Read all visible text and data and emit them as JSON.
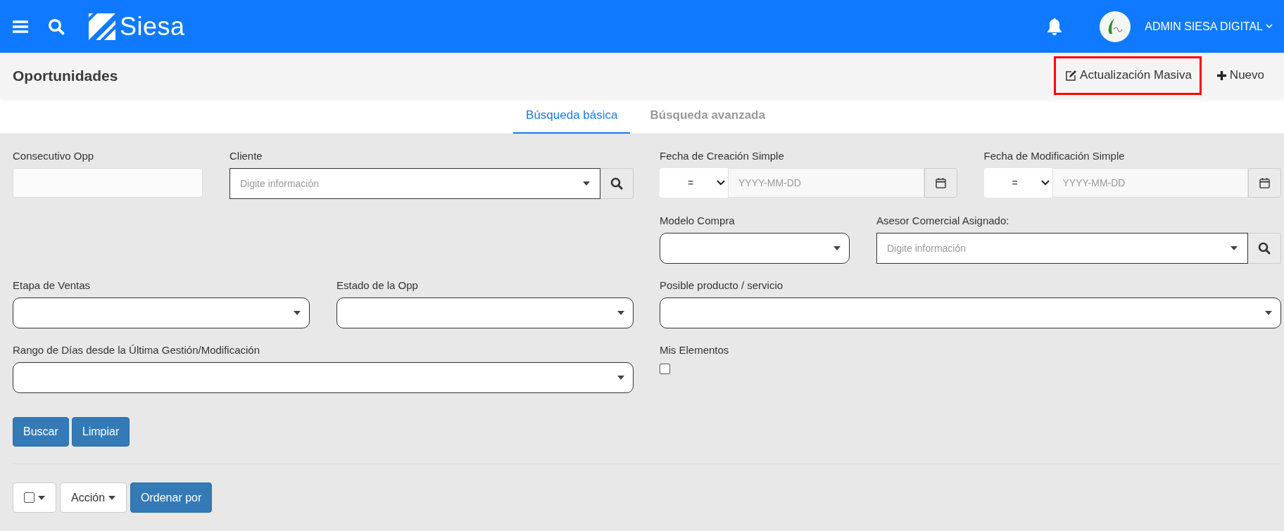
{
  "header": {
    "brand": "Siesa",
    "user": "ADMIN SIESA DIGITAL"
  },
  "page": {
    "title": "Oportunidades",
    "actions": [
      {
        "kind": "edit",
        "label": "Actualización Masiva",
        "highlighted": true
      },
      {
        "kind": "add",
        "label": "Nuevo",
        "highlighted": false
      }
    ]
  },
  "tabs": [
    {
      "label": "Búsqueda básica",
      "selected": true
    },
    {
      "label": "Búsqueda avanzada",
      "selected": false
    }
  ],
  "filter_rows": [
    {
      "left": [
        {
          "kind": "text",
          "label": "Consecutivo Opp"
        },
        {
          "kind": "lookup",
          "label": "Cliente",
          "placeholder": "Digite información"
        }
      ],
      "right": [
        {
          "kind": "date",
          "label": "Fecha de Creación Simple",
          "operator": "=",
          "placeholder": "YYYY-MM-DD"
        },
        {
          "kind": "date",
          "label": "Fecha de Modificación Simple",
          "operator": "=",
          "placeholder": "YYYY-MM-DD"
        }
      ]
    },
    {
      "left": [],
      "right": [
        {
          "kind": "select",
          "label": "Modelo Compra"
        },
        {
          "kind": "lookup",
          "label": "Asesor Comercial Asignado:",
          "placeholder": "Digite información"
        }
      ]
    },
    {
      "left": [
        {
          "kind": "select",
          "label": "Etapa de Ventas"
        },
        {
          "kind": "select",
          "label": "Estado de la Opp"
        }
      ],
      "right": [
        {
          "kind": "select",
          "label": "Posible producto / servicio"
        }
      ]
    },
    {
      "left": [
        {
          "kind": "select",
          "label": "Rango de Días desde la Última Gestión/Modificación"
        }
      ],
      "right": [
        {
          "kind": "checkbox",
          "label": "Mis Elementos",
          "checked": false
        }
      ]
    }
  ],
  "form_buttons": [
    "Buscar",
    "Limpiar"
  ],
  "list_toolbar": {
    "select_all_checked": false,
    "action_label": "Acción",
    "sort_label": "Ordenar por"
  }
}
